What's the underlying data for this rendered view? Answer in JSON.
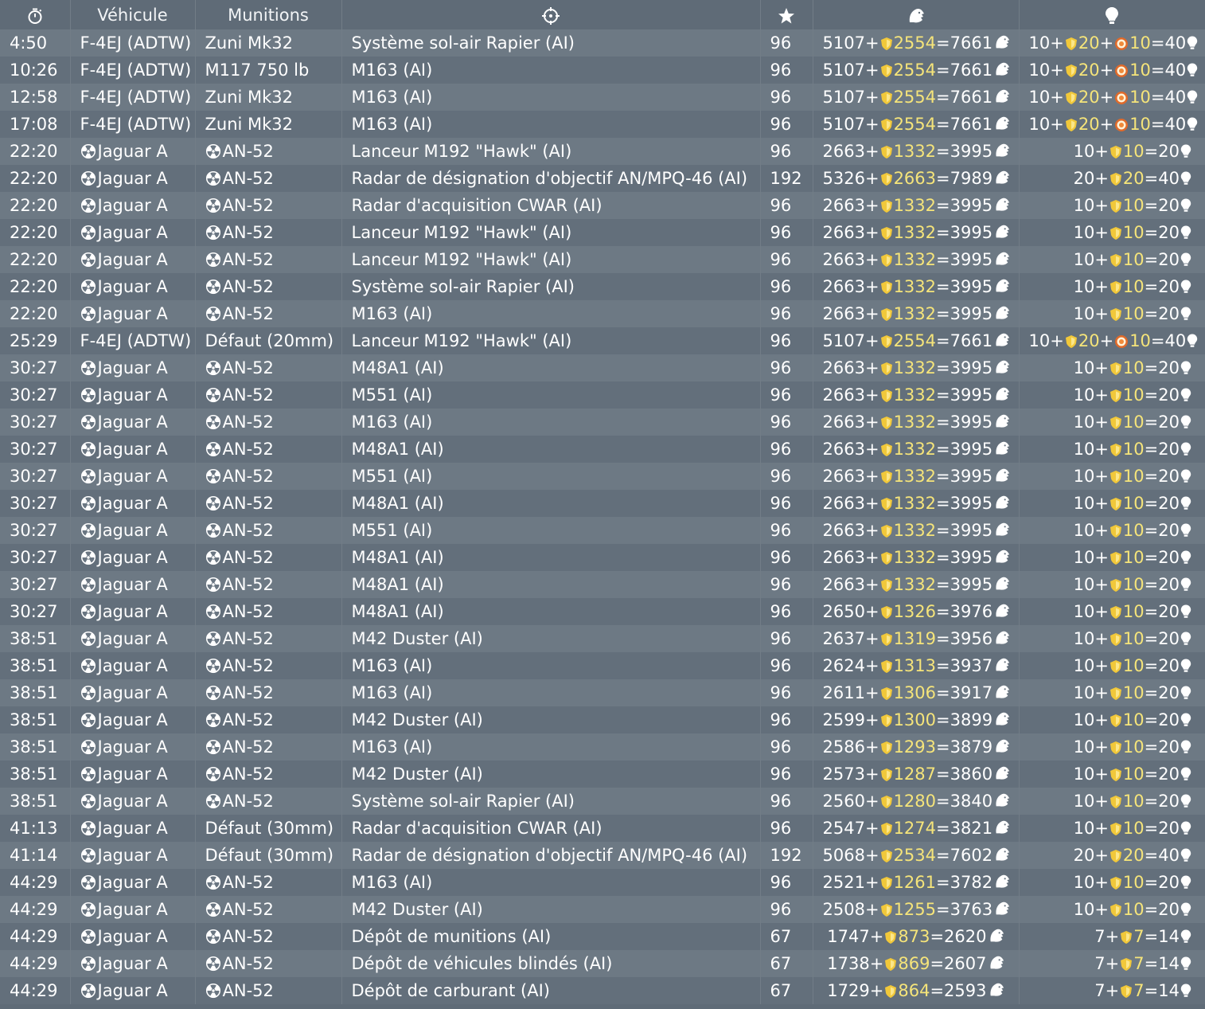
{
  "header": {
    "time_icon": "stopwatch-icon",
    "vehicle": "Véhicule",
    "munitions": "Munitions",
    "target_icon": "crosshair-icon",
    "score_icon": "star-icon",
    "silverlions_icon": "silver-lion-icon",
    "research_icon": "lightbulb-icon"
  },
  "colors": {
    "gold": "#f5e47a",
    "row_light": "#6d7984",
    "row_dark": "#636f7b"
  },
  "rows": [
    {
      "time": "4:50",
      "vehicle": "F-4EJ (ADTW)",
      "vnuke": false,
      "munition": "Zuni Mk32",
      "mnuke": false,
      "target": "Système sol-air Rapier (AI)",
      "score": "96",
      "sl_base": "5107",
      "sl_bonus": "2554",
      "sl_total": "7661",
      "rp_base": "10",
      "rp_bonus": "20",
      "rp_extra": "10",
      "rp_total": "40"
    },
    {
      "time": "10:26",
      "vehicle": "F-4EJ (ADTW)",
      "vnuke": false,
      "munition": "M117 750 lb",
      "mnuke": false,
      "target": "M163 (AI)",
      "score": "96",
      "sl_base": "5107",
      "sl_bonus": "2554",
      "sl_total": "7661",
      "rp_base": "10",
      "rp_bonus": "20",
      "rp_extra": "10",
      "rp_total": "40"
    },
    {
      "time": "12:58",
      "vehicle": "F-4EJ (ADTW)",
      "vnuke": false,
      "munition": "Zuni Mk32",
      "mnuke": false,
      "target": "M163 (AI)",
      "score": "96",
      "sl_base": "5107",
      "sl_bonus": "2554",
      "sl_total": "7661",
      "rp_base": "10",
      "rp_bonus": "20",
      "rp_extra": "10",
      "rp_total": "40"
    },
    {
      "time": "17:08",
      "vehicle": "F-4EJ (ADTW)",
      "vnuke": false,
      "munition": "Zuni Mk32",
      "mnuke": false,
      "target": "M163 (AI)",
      "score": "96",
      "sl_base": "5107",
      "sl_bonus": "2554",
      "sl_total": "7661",
      "rp_base": "10",
      "rp_bonus": "20",
      "rp_extra": "10",
      "rp_total": "40"
    },
    {
      "time": "22:20",
      "vehicle": "Jaguar A",
      "vnuke": true,
      "munition": "AN-52",
      "mnuke": true,
      "target": "Lanceur M192 \"Hawk\" (AI)",
      "score": "96",
      "sl_base": "2663",
      "sl_bonus": "1332",
      "sl_total": "3995",
      "rp_base": "10",
      "rp_bonus": "10",
      "rp_extra": "",
      "rp_total": "20"
    },
    {
      "time": "22:20",
      "vehicle": "Jaguar A",
      "vnuke": true,
      "munition": "AN-52",
      "mnuke": true,
      "target": "Radar de désignation d'objectif AN/MPQ-46 (AI)",
      "score": "192",
      "sl_base": "5326",
      "sl_bonus": "2663",
      "sl_total": "7989",
      "rp_base": "20",
      "rp_bonus": "20",
      "rp_extra": "",
      "rp_total": "40"
    },
    {
      "time": "22:20",
      "vehicle": "Jaguar A",
      "vnuke": true,
      "munition": "AN-52",
      "mnuke": true,
      "target": "Radar d'acquisition CWAR (AI)",
      "score": "96",
      "sl_base": "2663",
      "sl_bonus": "1332",
      "sl_total": "3995",
      "rp_base": "10",
      "rp_bonus": "10",
      "rp_extra": "",
      "rp_total": "20"
    },
    {
      "time": "22:20",
      "vehicle": "Jaguar A",
      "vnuke": true,
      "munition": "AN-52",
      "mnuke": true,
      "target": "Lanceur M192 \"Hawk\" (AI)",
      "score": "96",
      "sl_base": "2663",
      "sl_bonus": "1332",
      "sl_total": "3995",
      "rp_base": "10",
      "rp_bonus": "10",
      "rp_extra": "",
      "rp_total": "20"
    },
    {
      "time": "22:20",
      "vehicle": "Jaguar A",
      "vnuke": true,
      "munition": "AN-52",
      "mnuke": true,
      "target": "Lanceur M192 \"Hawk\" (AI)",
      "score": "96",
      "sl_base": "2663",
      "sl_bonus": "1332",
      "sl_total": "3995",
      "rp_base": "10",
      "rp_bonus": "10",
      "rp_extra": "",
      "rp_total": "20"
    },
    {
      "time": "22:20",
      "vehicle": "Jaguar A",
      "vnuke": true,
      "munition": "AN-52",
      "mnuke": true,
      "target": "Système sol-air Rapier (AI)",
      "score": "96",
      "sl_base": "2663",
      "sl_bonus": "1332",
      "sl_total": "3995",
      "rp_base": "10",
      "rp_bonus": "10",
      "rp_extra": "",
      "rp_total": "20"
    },
    {
      "time": "22:20",
      "vehicle": "Jaguar A",
      "vnuke": true,
      "munition": "AN-52",
      "mnuke": true,
      "target": "M163 (AI)",
      "score": "96",
      "sl_base": "2663",
      "sl_bonus": "1332",
      "sl_total": "3995",
      "rp_base": "10",
      "rp_bonus": "10",
      "rp_extra": "",
      "rp_total": "20"
    },
    {
      "time": "25:29",
      "vehicle": "F-4EJ (ADTW)",
      "vnuke": false,
      "munition": "Défaut (20mm)",
      "mnuke": false,
      "target": "Lanceur M192 \"Hawk\" (AI)",
      "score": "96",
      "sl_base": "5107",
      "sl_bonus": "2554",
      "sl_total": "7661",
      "rp_base": "10",
      "rp_bonus": "20",
      "rp_extra": "10",
      "rp_total": "40"
    },
    {
      "time": "30:27",
      "vehicle": "Jaguar A",
      "vnuke": true,
      "munition": "AN-52",
      "mnuke": true,
      "target": "M48A1 (AI)",
      "score": "96",
      "sl_base": "2663",
      "sl_bonus": "1332",
      "sl_total": "3995",
      "rp_base": "10",
      "rp_bonus": "10",
      "rp_extra": "",
      "rp_total": "20"
    },
    {
      "time": "30:27",
      "vehicle": "Jaguar A",
      "vnuke": true,
      "munition": "AN-52",
      "mnuke": true,
      "target": "M551 (AI)",
      "score": "96",
      "sl_base": "2663",
      "sl_bonus": "1332",
      "sl_total": "3995",
      "rp_base": "10",
      "rp_bonus": "10",
      "rp_extra": "",
      "rp_total": "20"
    },
    {
      "time": "30:27",
      "vehicle": "Jaguar A",
      "vnuke": true,
      "munition": "AN-52",
      "mnuke": true,
      "target": "M163 (AI)",
      "score": "96",
      "sl_base": "2663",
      "sl_bonus": "1332",
      "sl_total": "3995",
      "rp_base": "10",
      "rp_bonus": "10",
      "rp_extra": "",
      "rp_total": "20"
    },
    {
      "time": "30:27",
      "vehicle": "Jaguar A",
      "vnuke": true,
      "munition": "AN-52",
      "mnuke": true,
      "target": "M48A1 (AI)",
      "score": "96",
      "sl_base": "2663",
      "sl_bonus": "1332",
      "sl_total": "3995",
      "rp_base": "10",
      "rp_bonus": "10",
      "rp_extra": "",
      "rp_total": "20"
    },
    {
      "time": "30:27",
      "vehicle": "Jaguar A",
      "vnuke": true,
      "munition": "AN-52",
      "mnuke": true,
      "target": "M551 (AI)",
      "score": "96",
      "sl_base": "2663",
      "sl_bonus": "1332",
      "sl_total": "3995",
      "rp_base": "10",
      "rp_bonus": "10",
      "rp_extra": "",
      "rp_total": "20"
    },
    {
      "time": "30:27",
      "vehicle": "Jaguar A",
      "vnuke": true,
      "munition": "AN-52",
      "mnuke": true,
      "target": "M48A1 (AI)",
      "score": "96",
      "sl_base": "2663",
      "sl_bonus": "1332",
      "sl_total": "3995",
      "rp_base": "10",
      "rp_bonus": "10",
      "rp_extra": "",
      "rp_total": "20"
    },
    {
      "time": "30:27",
      "vehicle": "Jaguar A",
      "vnuke": true,
      "munition": "AN-52",
      "mnuke": true,
      "target": "M551 (AI)",
      "score": "96",
      "sl_base": "2663",
      "sl_bonus": "1332",
      "sl_total": "3995",
      "rp_base": "10",
      "rp_bonus": "10",
      "rp_extra": "",
      "rp_total": "20"
    },
    {
      "time": "30:27",
      "vehicle": "Jaguar A",
      "vnuke": true,
      "munition": "AN-52",
      "mnuke": true,
      "target": "M48A1 (AI)",
      "score": "96",
      "sl_base": "2663",
      "sl_bonus": "1332",
      "sl_total": "3995",
      "rp_base": "10",
      "rp_bonus": "10",
      "rp_extra": "",
      "rp_total": "20"
    },
    {
      "time": "30:27",
      "vehicle": "Jaguar A",
      "vnuke": true,
      "munition": "AN-52",
      "mnuke": true,
      "target": "M48A1 (AI)",
      "score": "96",
      "sl_base": "2663",
      "sl_bonus": "1332",
      "sl_total": "3995",
      "rp_base": "10",
      "rp_bonus": "10",
      "rp_extra": "",
      "rp_total": "20"
    },
    {
      "time": "30:27",
      "vehicle": "Jaguar A",
      "vnuke": true,
      "munition": "AN-52",
      "mnuke": true,
      "target": "M48A1 (AI)",
      "score": "96",
      "sl_base": "2650",
      "sl_bonus": "1326",
      "sl_total": "3976",
      "rp_base": "10",
      "rp_bonus": "10",
      "rp_extra": "",
      "rp_total": "20"
    },
    {
      "time": "38:51",
      "vehicle": "Jaguar A",
      "vnuke": true,
      "munition": "AN-52",
      "mnuke": true,
      "target": "M42 Duster (AI)",
      "score": "96",
      "sl_base": "2637",
      "sl_bonus": "1319",
      "sl_total": "3956",
      "rp_base": "10",
      "rp_bonus": "10",
      "rp_extra": "",
      "rp_total": "20"
    },
    {
      "time": "38:51",
      "vehicle": "Jaguar A",
      "vnuke": true,
      "munition": "AN-52",
      "mnuke": true,
      "target": "M163 (AI)",
      "score": "96",
      "sl_base": "2624",
      "sl_bonus": "1313",
      "sl_total": "3937",
      "rp_base": "10",
      "rp_bonus": "10",
      "rp_extra": "",
      "rp_total": "20"
    },
    {
      "time": "38:51",
      "vehicle": "Jaguar A",
      "vnuke": true,
      "munition": "AN-52",
      "mnuke": true,
      "target": "M163 (AI)",
      "score": "96",
      "sl_base": "2611",
      "sl_bonus": "1306",
      "sl_total": "3917",
      "rp_base": "10",
      "rp_bonus": "10",
      "rp_extra": "",
      "rp_total": "20"
    },
    {
      "time": "38:51",
      "vehicle": "Jaguar A",
      "vnuke": true,
      "munition": "AN-52",
      "mnuke": true,
      "target": "M42 Duster (AI)",
      "score": "96",
      "sl_base": "2599",
      "sl_bonus": "1300",
      "sl_total": "3899",
      "rp_base": "10",
      "rp_bonus": "10",
      "rp_extra": "",
      "rp_total": "20"
    },
    {
      "time": "38:51",
      "vehicle": "Jaguar A",
      "vnuke": true,
      "munition": "AN-52",
      "mnuke": true,
      "target": "M163 (AI)",
      "score": "96",
      "sl_base": "2586",
      "sl_bonus": "1293",
      "sl_total": "3879",
      "rp_base": "10",
      "rp_bonus": "10",
      "rp_extra": "",
      "rp_total": "20"
    },
    {
      "time": "38:51",
      "vehicle": "Jaguar A",
      "vnuke": true,
      "munition": "AN-52",
      "mnuke": true,
      "target": "M42 Duster (AI)",
      "score": "96",
      "sl_base": "2573",
      "sl_bonus": "1287",
      "sl_total": "3860",
      "rp_base": "10",
      "rp_bonus": "10",
      "rp_extra": "",
      "rp_total": "20"
    },
    {
      "time": "38:51",
      "vehicle": "Jaguar A",
      "vnuke": true,
      "munition": "AN-52",
      "mnuke": true,
      "target": "Système sol-air Rapier (AI)",
      "score": "96",
      "sl_base": "2560",
      "sl_bonus": "1280",
      "sl_total": "3840",
      "rp_base": "10",
      "rp_bonus": "10",
      "rp_extra": "",
      "rp_total": "20"
    },
    {
      "time": "41:13",
      "vehicle": "Jaguar A",
      "vnuke": true,
      "munition": "Défaut (30mm)",
      "mnuke": false,
      "target": "Radar d'acquisition CWAR (AI)",
      "score": "96",
      "sl_base": "2547",
      "sl_bonus": "1274",
      "sl_total": "3821",
      "rp_base": "10",
      "rp_bonus": "10",
      "rp_extra": "",
      "rp_total": "20"
    },
    {
      "time": "41:14",
      "vehicle": "Jaguar A",
      "vnuke": true,
      "munition": "Défaut (30mm)",
      "mnuke": false,
      "target": "Radar de désignation d'objectif AN/MPQ-46 (AI)",
      "score": "192",
      "sl_base": "5068",
      "sl_bonus": "2534",
      "sl_total": "7602",
      "rp_base": "20",
      "rp_bonus": "20",
      "rp_extra": "",
      "rp_total": "40"
    },
    {
      "time": "44:29",
      "vehicle": "Jaguar A",
      "vnuke": true,
      "munition": "AN-52",
      "mnuke": true,
      "target": "M163 (AI)",
      "score": "96",
      "sl_base": "2521",
      "sl_bonus": "1261",
      "sl_total": "3782",
      "rp_base": "10",
      "rp_bonus": "10",
      "rp_extra": "",
      "rp_total": "20"
    },
    {
      "time": "44:29",
      "vehicle": "Jaguar A",
      "vnuke": true,
      "munition": "AN-52",
      "mnuke": true,
      "target": "M42 Duster (AI)",
      "score": "96",
      "sl_base": "2508",
      "sl_bonus": "1255",
      "sl_total": "3763",
      "rp_base": "10",
      "rp_bonus": "10",
      "rp_extra": "",
      "rp_total": "20"
    },
    {
      "time": "44:29",
      "vehicle": "Jaguar A",
      "vnuke": true,
      "munition": "AN-52",
      "mnuke": true,
      "target": "Dépôt de munitions (AI)",
      "score": "67",
      "sl_base": "1747",
      "sl_bonus": "873",
      "sl_total": "2620",
      "rp_base": "7",
      "rp_bonus": "7",
      "rp_extra": "",
      "rp_total": "14"
    },
    {
      "time": "44:29",
      "vehicle": "Jaguar A",
      "vnuke": true,
      "munition": "AN-52",
      "mnuke": true,
      "target": "Dépôt de véhicules blindés (AI)",
      "score": "67",
      "sl_base": "1738",
      "sl_bonus": "869",
      "sl_total": "2607",
      "rp_base": "7",
      "rp_bonus": "7",
      "rp_extra": "",
      "rp_total": "14"
    },
    {
      "time": "44:29",
      "vehicle": "Jaguar A",
      "vnuke": true,
      "munition": "AN-52",
      "mnuke": true,
      "target": "Dépôt de carburant (AI)",
      "score": "67",
      "sl_base": "1729",
      "sl_bonus": "864",
      "sl_total": "2593",
      "rp_base": "7",
      "rp_bonus": "7",
      "rp_extra": "",
      "rp_total": "14"
    }
  ]
}
